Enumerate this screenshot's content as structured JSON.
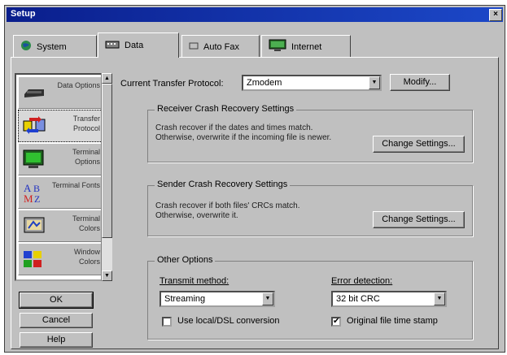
{
  "window": {
    "title": "Setup",
    "close_label": "×"
  },
  "tabs": [
    {
      "label": "System",
      "icon": "globe-icon"
    },
    {
      "label": "Data",
      "icon": "keyboard-icon"
    },
    {
      "label": "Auto Fax",
      "icon": "fax-icon"
    },
    {
      "label": "Internet",
      "icon": "monitor-icon"
    }
  ],
  "active_tab": "Data",
  "categories": [
    {
      "label": "Data Options",
      "icon": "modem-icon"
    },
    {
      "label": "Transfer Protocol",
      "icon": "transfer-icon"
    },
    {
      "label": "Terminal Options",
      "icon": "terminal-icon"
    },
    {
      "label": "Terminal Fonts",
      "icon": "fonts-icon"
    },
    {
      "label": "Terminal Colors",
      "icon": "colors-icon"
    },
    {
      "label": "Window Colors",
      "icon": "palette-icon"
    }
  ],
  "selected_category": "Transfer Protocol",
  "buttons": {
    "ok": "OK",
    "cancel": "Cancel",
    "help": "Help"
  },
  "protocol": {
    "label": "Current Transfer Protocol:",
    "value": "Zmodem",
    "modify_label": "Modify..."
  },
  "receiver_group": {
    "title": "Receiver Crash Recovery Settings",
    "text_line1": "Crash recover if the dates and times match.",
    "text_line2": "Otherwise, overwrite if the incoming file is newer.",
    "button": "Change Settings..."
  },
  "sender_group": {
    "title": "Sender Crash Recovery Settings",
    "text_line1": "Crash recover if both files' CRCs match.",
    "text_line2": "Otherwise, overwrite it.",
    "button": "Change Settings..."
  },
  "other_options": {
    "title": "Other Options",
    "transmit_label": "Transmit method:",
    "transmit_value": "Streaming",
    "error_label": "Error detection:",
    "error_value": "32 bit CRC",
    "checkbox1_label": "Use local/DSL conversion",
    "checkbox1_checked": false,
    "checkbox2_label": "Original file time stamp",
    "checkbox2_checked": true,
    "check_mark": "✔"
  },
  "scroll_up": "▲",
  "scroll_down": "▼",
  "combo_arrow": "▼"
}
